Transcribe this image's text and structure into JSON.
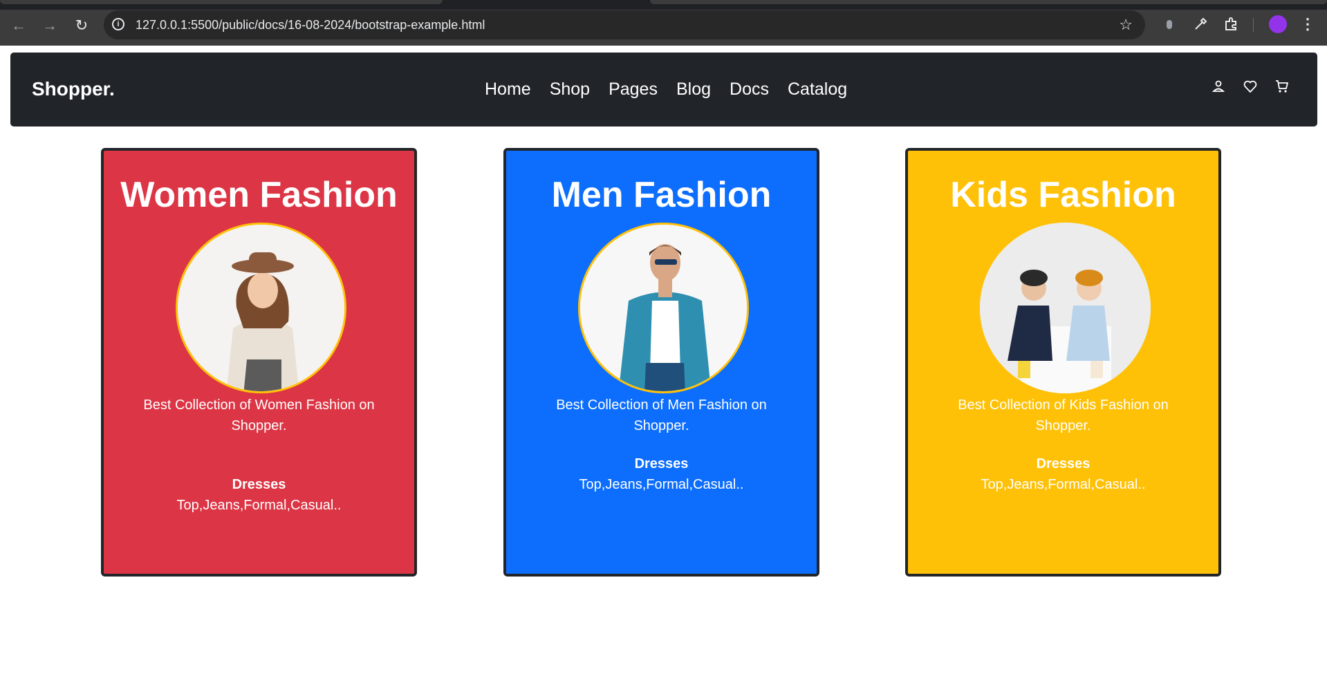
{
  "browser": {
    "url": "127.0.0.1:5500/public/docs/16-08-2024/bootstrap-example.html",
    "back_icon": "←",
    "forward_icon": "→",
    "reload_icon": "↻",
    "star_icon": "☆",
    "kebab_icon": "⋮",
    "profile_color": "#9333ea"
  },
  "navbar": {
    "brand": "Shopper.",
    "links": [
      "Home",
      "Shop",
      "Pages",
      "Blog",
      "Docs",
      "Catalog"
    ],
    "icons": [
      "user-icon",
      "heart-icon",
      "cart-icon"
    ]
  },
  "cards": [
    {
      "title": "Women Fashion",
      "description": "Best Collection of Women Fashion on Shopper.",
      "category": "Dresses",
      "items": "Top,Jeans,Formal,Casual..",
      "color": "#dc3545"
    },
    {
      "title": "Men Fashion",
      "description": "Best Collection of Men Fashion on Shopper.",
      "category": "Dresses",
      "items": "Top,Jeans,Formal,Casual..",
      "color": "#0d6efd"
    },
    {
      "title": "Kids Fashion",
      "description": "Best Collection of Kids Fashion on Shopper.",
      "category": "Dresses",
      "items": "Top,Jeans,Formal,Casual..",
      "color": "#ffc107"
    }
  ]
}
